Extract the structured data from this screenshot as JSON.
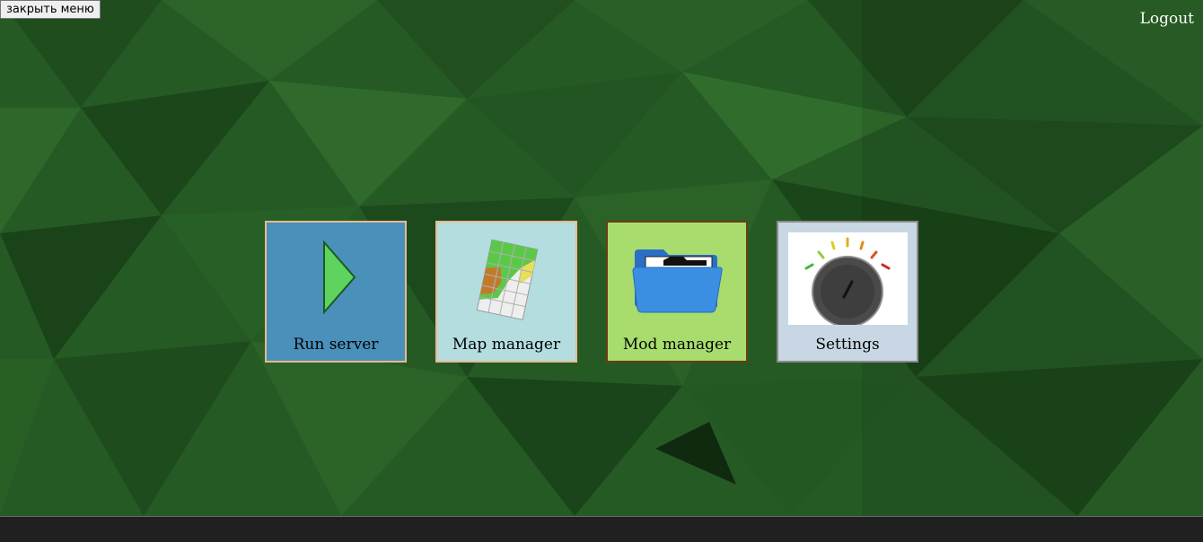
{
  "header": {
    "close_menu_label": "закрыть меню",
    "logout_label": "Logout"
  },
  "tiles": [
    {
      "label": "Run server",
      "icon": "play-icon",
      "bg": "#4990bb",
      "border": "#e9b991"
    },
    {
      "label": "Map manager",
      "icon": "map-icon",
      "bg": "#b4dde0",
      "border": "#e9b991"
    },
    {
      "label": "Mod manager",
      "icon": "folder-icon",
      "bg": "#a8dd6e",
      "border": "#6b3c12"
    },
    {
      "label": "Settings",
      "icon": "knob-dial-icon",
      "bg": "#c9d6e3",
      "border": "#8b8b8b"
    }
  ],
  "colors": {
    "background": "#234f22",
    "bottom_bar": "#202020"
  }
}
